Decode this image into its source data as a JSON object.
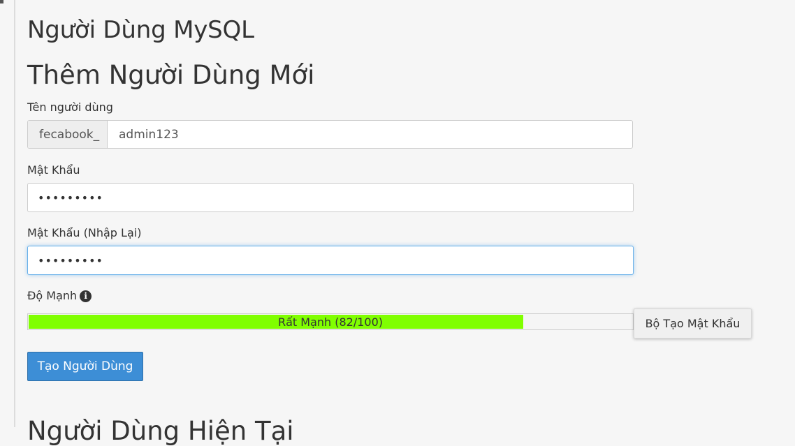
{
  "page_title": "Người Dùng MySQL",
  "section_title": "Thêm Người Dùng Mới",
  "username": {
    "label": "Tên người dùng",
    "prefix": "fecabook_",
    "value": "admin123"
  },
  "password": {
    "label": "Mật Khẩu",
    "value": "•••••••••"
  },
  "password_confirm": {
    "label": "Mật Khẩu (Nhập Lại)",
    "value": "•••••••••"
  },
  "strength": {
    "label": "Độ Mạnh",
    "info_icon": "info-icon",
    "text": "Rất Mạnh (82/100)",
    "score": 82,
    "bar_color": "#80ff00"
  },
  "generator_button": "Bộ Tạo Mật Khẩu",
  "create_button": "Tạo Người Dùng",
  "next_section_title": "Người Dùng Hiện Tại"
}
